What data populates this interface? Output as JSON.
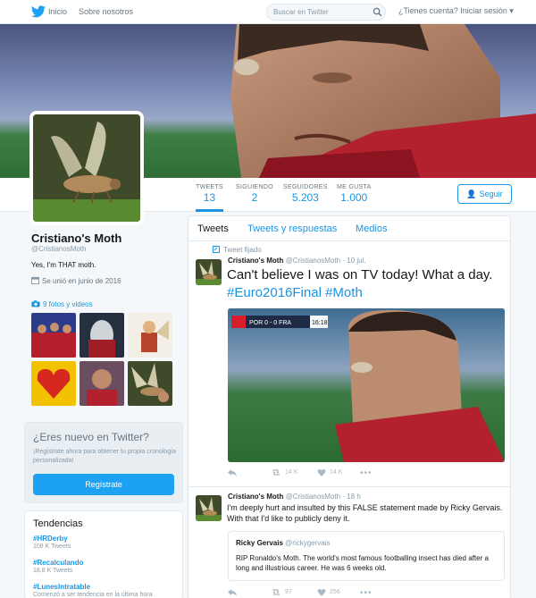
{
  "nav": {
    "home": "Inicio",
    "about": "Sobre nosotros",
    "search_placeholder": "Buscar en Twitter",
    "login": "¿Tienes cuenta? Iniciar sesión"
  },
  "stats": [
    {
      "label": "TWEETS",
      "value": "13"
    },
    {
      "label": "SIGUIENDO",
      "value": "2"
    },
    {
      "label": "SEGUIDORES",
      "value": "5.203"
    },
    {
      "label": "ME GUSTA",
      "value": "1.000"
    }
  ],
  "follow_label": "Seguir",
  "profile": {
    "name": "Cristiano's Moth",
    "handle": "@CristianosMoth",
    "bio": "Yes, I'm THAT moth.",
    "joined": "Se unió en junio de 2016",
    "media_link": "9 fotos y videos"
  },
  "signup": {
    "title": "¿Eres nuevo en Twitter?",
    "text": "¡Regístrate ahora para obtener tu propia cronología personalizada!",
    "button": "Regístrate"
  },
  "trends": {
    "title": "Tendencias",
    "items": [
      {
        "tag": "#HRDerby",
        "meta": "108 K Tweets"
      },
      {
        "tag": "#Recalculando",
        "meta": "18,8 K Tweets"
      },
      {
        "tag": "#LunesIntratable",
        "meta": "Comenzó a ser tendencia en la última hora"
      }
    ]
  },
  "tabs": [
    "Tweets",
    "Tweets y respuestas",
    "Medios"
  ],
  "tweets": [
    {
      "pinned_label": "Tweet fijado",
      "name": "Cristiano's Moth",
      "handle": "@CristianosMoth",
      "date": "· 10 jul.",
      "text_start": "Can't believe I was on TV today! What a day.",
      "hashtag1": "#Euro2016Final",
      "hashtag2": "#Moth",
      "retweets": "14 K",
      "likes": "14 K",
      "scoreboard": "POR 0 - 0 FRA",
      "clock": "16:18"
    },
    {
      "name": "Cristiano's Moth",
      "handle": "@CristianosMoth",
      "date": "· 18 h",
      "text": "I'm deeply hurt and insulted by this FALSE statement made by Ricky Gervais. With that I'd like to publicly deny it.",
      "quote_name": "Ricky Gervais",
      "quote_handle": "@rickygervais",
      "quote_text": "RIP Ronaldo's Moth. The world's most famous footballing insect has died after a long and illustrious career. He was 6 weeks old.",
      "retweets": "97",
      "likes": "256"
    }
  ],
  "colors": {
    "accent": "#1b95e0",
    "signup_button": "#1da1f2",
    "background": "#f5f8fa"
  }
}
